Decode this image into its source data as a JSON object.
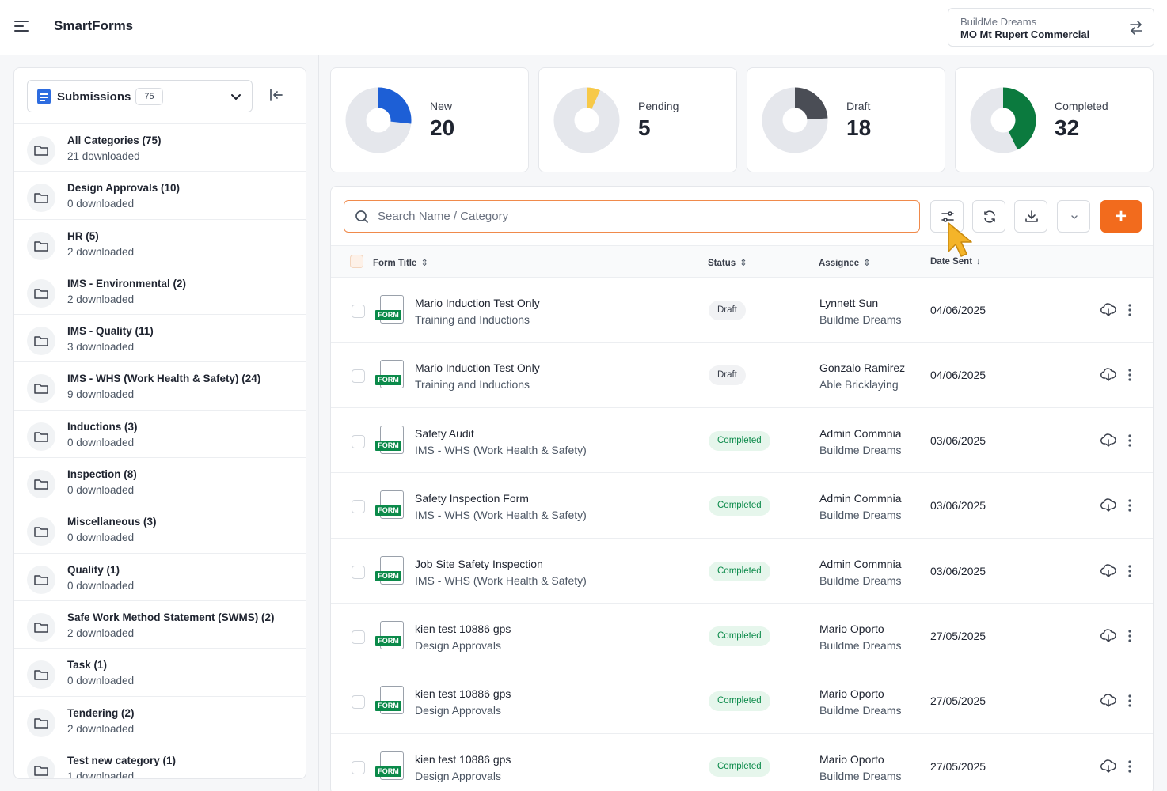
{
  "app": {
    "title": "SmartForms"
  },
  "company": {
    "name": "BuildMe Dreams",
    "site": "MO Mt Rupert Commercial"
  },
  "sidebar": {
    "selector_label": "Submissions",
    "selector_count": "75",
    "categories": [
      {
        "name": "All Categories (75)",
        "downloaded": "21 downloaded"
      },
      {
        "name": "Design Approvals (10)",
        "downloaded": "0 downloaded"
      },
      {
        "name": "HR (5)",
        "downloaded": "2 downloaded"
      },
      {
        "name": "IMS - Environmental (2)",
        "downloaded": "2 downloaded"
      },
      {
        "name": "IMS - Quality (11)",
        "downloaded": "3 downloaded"
      },
      {
        "name": "IMS - WHS (Work Health & Safety) (24)",
        "downloaded": "9 downloaded"
      },
      {
        "name": "Inductions (3)",
        "downloaded": "0 downloaded"
      },
      {
        "name": "Inspection (8)",
        "downloaded": "0 downloaded"
      },
      {
        "name": "Miscellaneous (3)",
        "downloaded": "0 downloaded"
      },
      {
        "name": "Quality (1)",
        "downloaded": "0 downloaded"
      },
      {
        "name": "Safe Work Method Statement (SWMS) (2)",
        "downloaded": "2 downloaded"
      },
      {
        "name": "Task (1)",
        "downloaded": "0 downloaded"
      },
      {
        "name": "Tendering (2)",
        "downloaded": "2 downloaded"
      },
      {
        "name": "Test new category (1)",
        "downloaded": "1 downloaded"
      }
    ]
  },
  "stats": [
    {
      "label": "New",
      "value": "20",
      "fraction": 0.267,
      "color": "#1d5fd6"
    },
    {
      "label": "Pending",
      "value": "5",
      "fraction": 0.067,
      "color": "#f7c948"
    },
    {
      "label": "Draft",
      "value": "18",
      "fraction": 0.24,
      "color": "#4a4d55"
    },
    {
      "label": "Completed",
      "value": "32",
      "fraction": 0.427,
      "color": "#0b7a3e"
    }
  ],
  "search": {
    "placeholder": "Search Name / Category",
    "value": ""
  },
  "table": {
    "headers": {
      "title": "Form Title",
      "status": "Status",
      "assignee": "Assignee",
      "date": "Date Sent"
    },
    "form_tag": "FORM",
    "rows": [
      {
        "title": "Mario Induction Test Only",
        "category": "Training and Inductions",
        "status": "Draft",
        "assignee": "Lynnett Sun",
        "company": "Buildme Dreams",
        "date": "04/06/2025"
      },
      {
        "title": "Mario Induction Test Only",
        "category": "Training and Inductions",
        "status": "Draft",
        "assignee": "Gonzalo Ramirez",
        "company": "Able Bricklaying",
        "date": "04/06/2025"
      },
      {
        "title": "Safety Audit",
        "category": "IMS - WHS (Work Health & Safety)",
        "status": "Completed",
        "assignee": "Admin Commnia",
        "company": "Buildme Dreams",
        "date": "03/06/2025"
      },
      {
        "title": "Safety Inspection Form",
        "category": "IMS - WHS (Work Health & Safety)",
        "status": "Completed",
        "assignee": "Admin Commnia",
        "company": "Buildme Dreams",
        "date": "03/06/2025"
      },
      {
        "title": "Job Site Safety Inspection",
        "category": "IMS - WHS (Work Health & Safety)",
        "status": "Completed",
        "assignee": "Admin Commnia",
        "company": "Buildme Dreams",
        "date": "03/06/2025"
      },
      {
        "title": "kien test 10886 gps",
        "category": "Design Approvals",
        "status": "Completed",
        "assignee": "Mario Oporto",
        "company": "Buildme Dreams",
        "date": "27/05/2025"
      },
      {
        "title": "kien test 10886 gps",
        "category": "Design Approvals",
        "status": "Completed",
        "assignee": "Mario Oporto",
        "company": "Buildme Dreams",
        "date": "27/05/2025"
      },
      {
        "title": "kien test 10886 gps",
        "category": "Design Approvals",
        "status": "Completed",
        "assignee": "Mario Oporto",
        "company": "Buildme Dreams",
        "date": "27/05/2025"
      }
    ]
  },
  "icons": {
    "menu": "hamburger-icon",
    "switch": "switch-arrows-icon",
    "collapse": "collapse-left-icon",
    "folder": "folder-icon",
    "search": "search-icon",
    "filter": "filter-icon",
    "refresh": "refresh-icon",
    "download": "download-icon",
    "chevron": "chevron-down-icon",
    "add": "plus-icon",
    "more": "more-vertical-icon"
  }
}
